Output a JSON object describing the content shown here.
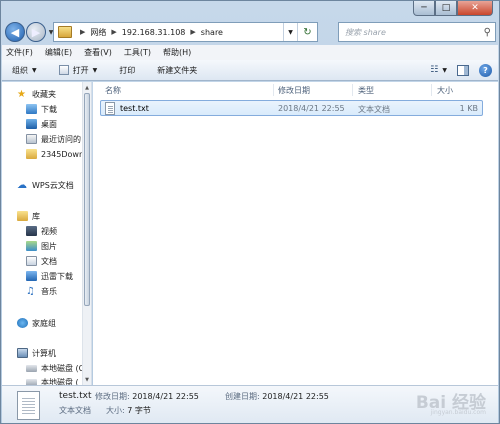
{
  "window": {
    "controls": {
      "minimize": "─",
      "maximize": "□",
      "close": "✕"
    }
  },
  "address": {
    "crumbs": [
      "网络",
      "192.168.31.108",
      "share"
    ]
  },
  "search": {
    "placeholder": "搜索 share"
  },
  "menubar": {
    "items": [
      "文件(F)",
      "编辑(E)",
      "查看(V)",
      "工具(T)",
      "帮助(H)"
    ]
  },
  "toolbar": {
    "organize": "组织",
    "open": "打开",
    "print": "打印",
    "new_folder": "新建文件夹"
  },
  "nav": {
    "favorites": "收藏夹",
    "downloads": "下载",
    "desktop": "桌面",
    "recent": "最近访问的",
    "folder2345": "2345Down",
    "wps": "WPS云文档",
    "libraries": "库",
    "videos": "视频",
    "pictures": "图片",
    "documents": "文档",
    "thunder": "迅雷下载",
    "music": "音乐",
    "homegroup": "家庭组",
    "computer": "计算机",
    "disk_c": "本地磁盘 (C",
    "disk_d": "本地磁盘 ("
  },
  "columns": {
    "name": "名称",
    "modified": "修改日期",
    "type": "类型",
    "size": "大小"
  },
  "files": [
    {
      "name": "test.txt",
      "modified": "2018/4/21 22:55",
      "type": "文本文档",
      "size": "1 KB"
    }
  ],
  "details": {
    "filename": "test.txt",
    "modified_label": "修改日期:",
    "modified_value": "2018/4/21 22:55",
    "created_label": "创建日期:",
    "created_value": "2018/4/21 22:55",
    "type": "文本文档",
    "size_label": "大小:",
    "size_value": "7 字节"
  },
  "watermark": {
    "text": "Bai 经验",
    "sub": "jingyan.baidu.com"
  }
}
